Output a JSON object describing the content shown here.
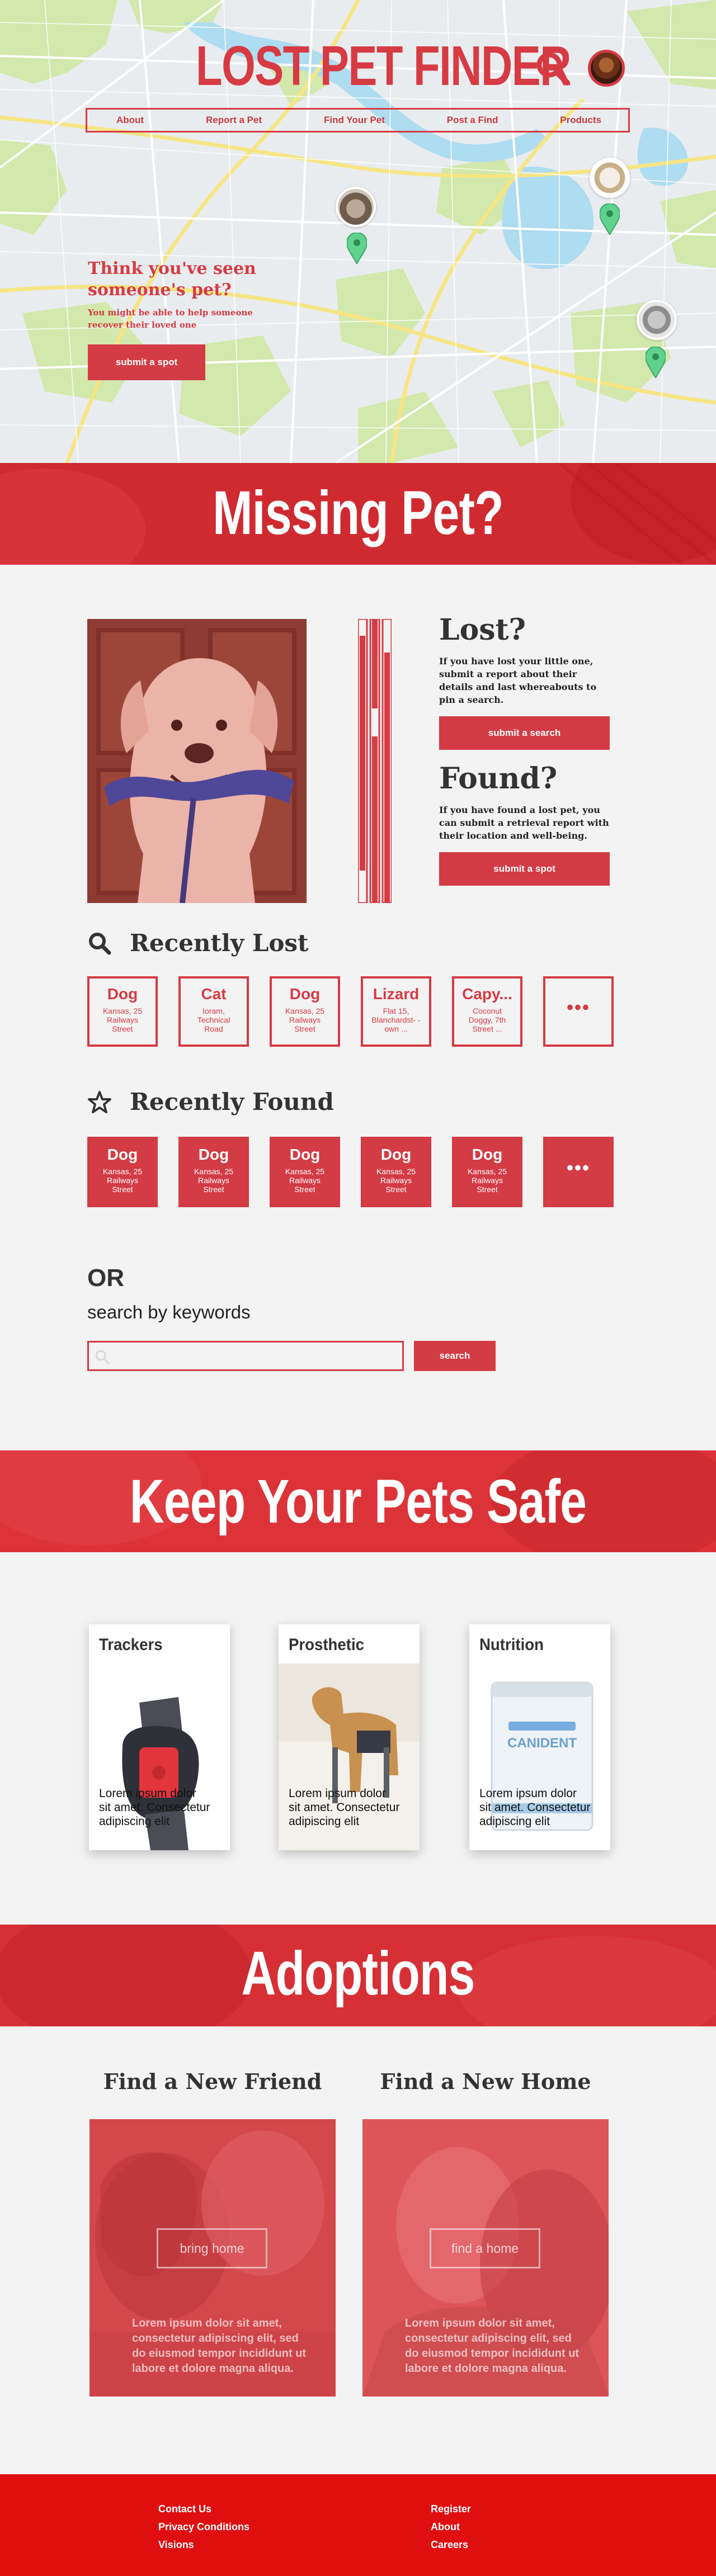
{
  "brand": {
    "title": "LOST PET FINDER"
  },
  "nav": [
    {
      "label": "About"
    },
    {
      "label": "Report a Pet"
    },
    {
      "label": "Find Your Pet"
    },
    {
      "label": "Post a Find"
    },
    {
      "label": "Products"
    }
  ],
  "hero": {
    "heading": "Think you've seen someone's pet?",
    "text": "You might be able to help someone recover their loved one",
    "button": "submit a spot"
  },
  "missing": {
    "banner": "Missing Pet?",
    "lost_title": "Lost?",
    "lost_text": "If you have lost your little one, submit a report about their details and last whereabouts to pin a search.",
    "lost_button": "submit a search",
    "found_title": "Found?",
    "found_text": "If you have found a lost pet, you can submit a retrieval report with their location and well-being.",
    "found_button": "submit a spot"
  },
  "recently_lost": {
    "title": "Recently Lost",
    "items": [
      {
        "species": "Dog",
        "address": "Kansas, 25 Railways Street"
      },
      {
        "species": "Cat",
        "address": "Ioram, Technical Road"
      },
      {
        "species": "Dog",
        "address": "Kansas, 25 Railways Street"
      },
      {
        "species": "Lizard",
        "address": "Flat 15, Blanchardst- -own ..."
      },
      {
        "species": "Capy...",
        "address": "Coconut Doggy, 7th Street ..."
      }
    ],
    "more": "•••"
  },
  "recently_found": {
    "title": "Recently Found",
    "items": [
      {
        "species": "Dog",
        "address": "Kansas, 25 Railways Street"
      },
      {
        "species": "Dog",
        "address": "Kansas, 25 Railways Street"
      },
      {
        "species": "Dog",
        "address": "Kansas, 25 Railways Street"
      },
      {
        "species": "Dog",
        "address": "Kansas, 25 Railways Street"
      },
      {
        "species": "Dog",
        "address": "Kansas, 25 Railways Street"
      }
    ],
    "more": "•••"
  },
  "keyword_search": {
    "or": "OR",
    "subtitle": "search by keywords",
    "placeholder": "",
    "button": "search"
  },
  "safety": {
    "banner": "Keep Your Pets Safe",
    "products": [
      {
        "title": "Trackers",
        "desc": "Lorem ipsum dolor sit amet. Consectetur adipiscing elit"
      },
      {
        "title": "Prosthetic",
        "desc": "Lorem ipsum dolor sit amet. Consectetur adipiscing elit"
      },
      {
        "title": "Nutrition",
        "desc": "Lorem ipsum dolor sit amet. Consectetur adipiscing elit",
        "label": "CANIDENT"
      }
    ]
  },
  "adoptions": {
    "banner": "Adoptions",
    "cards": [
      {
        "title": "Find a New Friend",
        "button": "bring home",
        "text": "Lorem ipsum dolor sit amet, consectetur adipiscing elit, sed do eiusmod tempor incididunt ut labore et dolore magna aliqua."
      },
      {
        "title": "Find a New Home",
        "button": "find a home",
        "text": "Lorem ipsum dolor sit amet, consectetur adipiscing elit, sed do eiusmod tempor incididunt ut labore et dolore magna aliqua."
      }
    ]
  },
  "footer": {
    "left": [
      "Contact Us",
      "Privacy Conditions",
      "Visions"
    ],
    "right": [
      "Register",
      "About",
      "Careers"
    ]
  },
  "colors": {
    "accent": "#d63b44",
    "banner": "#cf2d34",
    "footer": "#df0f10",
    "background": "#f3f3f3",
    "pin": "#5fd28e"
  }
}
